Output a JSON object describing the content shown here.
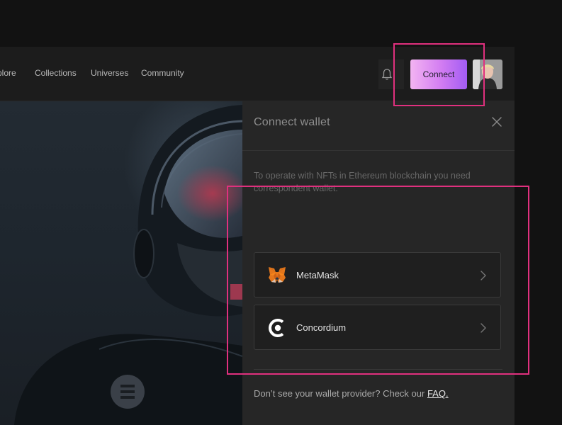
{
  "nav": {
    "links": [
      "xplore",
      "Collections",
      "Universes",
      "Community"
    ],
    "connect_label": "Connect"
  },
  "wallet_panel": {
    "title": "Connect wallet",
    "description": "To operate with NFTs in Ethereum blockchain you need correspondent wallet.",
    "options": [
      {
        "label": "MetaMask",
        "icon": "metamask-fox-icon"
      },
      {
        "label": "Concordium",
        "icon": "concordium-icon"
      }
    ],
    "faq_prefix": "Don’t see your wallet provider? Check our ",
    "faq_link": "FAQ."
  },
  "colors": {
    "highlight": "#e0307e",
    "connect_gradient_start": "#f3b4f2",
    "connect_gradient_end": "#a25cf3",
    "panel_bg": "#262626",
    "page_bg": "#121212"
  }
}
